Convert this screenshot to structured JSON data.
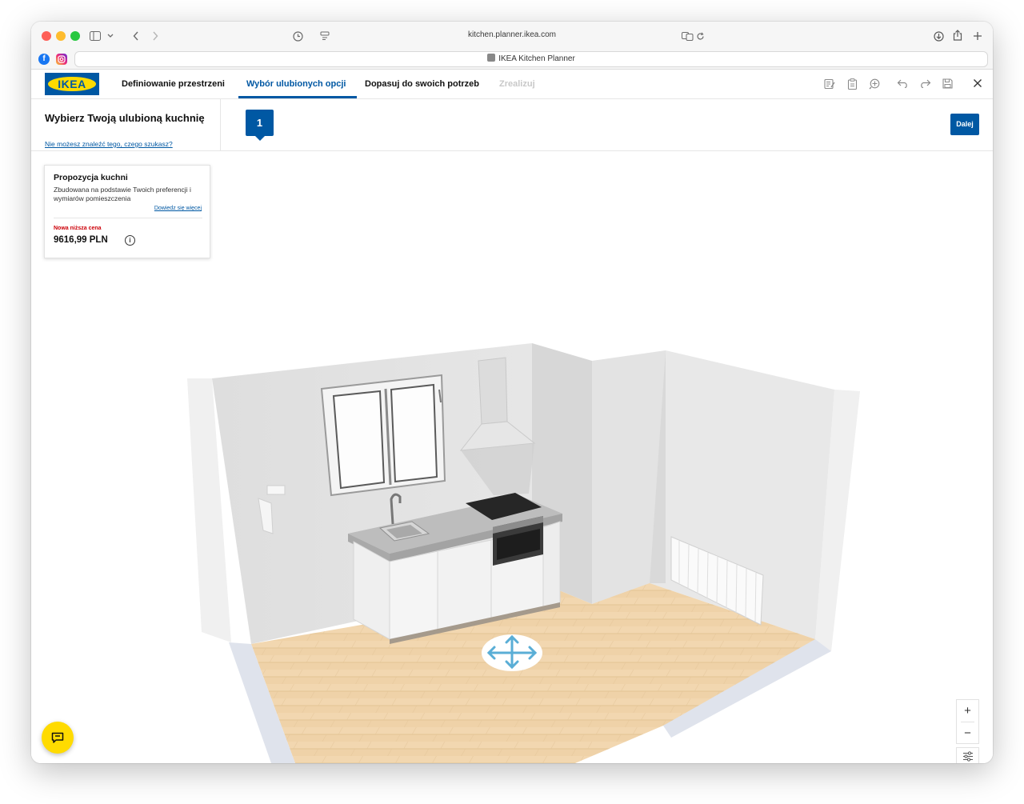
{
  "browser": {
    "url": "kitchen.planner.ikea.com",
    "tab_title": "IKEA Kitchen Planner"
  },
  "app": {
    "logo_text": "IKEA",
    "nav": [
      {
        "label": "Definiowanie przestrzeni",
        "state": "normal"
      },
      {
        "label": "Wybór ulubionych opcji",
        "state": "active"
      },
      {
        "label": "Dopasuj do swoich potrzeb",
        "state": "normal"
      },
      {
        "label": "Zrealizuj",
        "state": "disabled"
      }
    ],
    "colors": {
      "brand_blue": "#0058a3",
      "brand_yellow": "#ffdb00",
      "alert_red": "#cc0008"
    }
  },
  "subheader": {
    "title": "Wybierz Twoją ulubioną kuchnię",
    "help_link": "Nie możesz znaleźć tego, czego szukasz?",
    "step": "1",
    "next_label": "Dalej"
  },
  "proposal": {
    "title": "Propozycja kuchni",
    "description": "Zbudowana na podstawie Twoich preferencji i wymiarów pomieszczenia",
    "learn_more": "Dowiedz się więcej",
    "badge": "Nowa niższa cena",
    "price": "9616,99 PLN"
  },
  "controls": {
    "zoom_in": "+",
    "zoom_out": "−"
  }
}
